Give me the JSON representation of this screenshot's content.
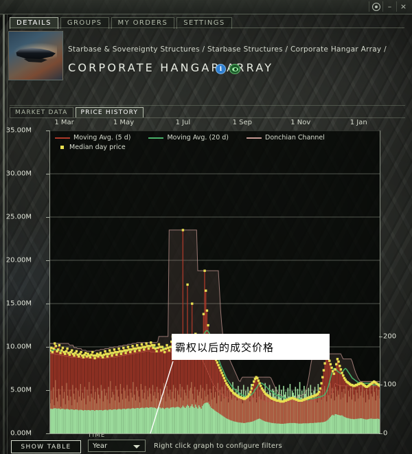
{
  "window": {
    "controls": [
      {
        "name": "target-icon",
        "label": ""
      },
      {
        "name": "minimize-button",
        "label": "–"
      },
      {
        "name": "close-button",
        "label": "×"
      }
    ]
  },
  "tabs": [
    {
      "label": "DETAILS",
      "active": true
    },
    {
      "label": "GROUPS",
      "active": false
    },
    {
      "label": "MY ORDERS",
      "active": false
    },
    {
      "label": "SETTINGS",
      "active": false
    }
  ],
  "header": {
    "breadcrumb": "Starbase & Sovereignty Structures / Starbase Structures / Corporate Hangar Array /",
    "title": "CORPORATE HANGAR ARRAY",
    "info_icon": "i",
    "eye_icon": "eye-icon"
  },
  "subtabs": [
    {
      "label": "MARKET DATA",
      "active": false
    },
    {
      "label": "PRICE HISTORY",
      "active": true
    }
  ],
  "annotation": {
    "text": "霸权以后的成交价格"
  },
  "footer": {
    "show_table": "SHOW TABLE",
    "time_label": "TIME",
    "time_value": "Year",
    "hint": "Right click graph to configure filters"
  },
  "colors": {
    "ma5": "#b03a2a",
    "ma20": "#49b36a",
    "donchian": "#c79a94",
    "median": "#e8e052",
    "volume": "#a9efa9",
    "annotation_line": "#ffffff",
    "grid": "#8d9487"
  },
  "chart_data": {
    "type": "line",
    "title": "",
    "xlabel": "",
    "ylabel": "",
    "ylim": [
      0,
      35000000
    ],
    "y2lim": [
      0,
      250
    ],
    "grid": true,
    "legend_position": "top-left",
    "x_tick_labels": [
      "1 Mar",
      "1 May",
      "1 Jul",
      "1 Sep",
      "1 Nov",
      "1 Jan"
    ],
    "x_tick_positions": [
      0.045,
      0.225,
      0.405,
      0.585,
      0.762,
      0.938
    ],
    "y_tick_labels": [
      "0.00M",
      "5.00M",
      "10.00M",
      "15.00M",
      "20.00M",
      "25.00M",
      "30.00M",
      "35.00M"
    ],
    "y_tick_values": [
      0,
      5000000,
      10000000,
      15000000,
      20000000,
      25000000,
      30000000,
      35000000
    ],
    "y2_tick_labels": [
      "0",
      "100",
      "200"
    ],
    "y2_tick_values": [
      0,
      100,
      200
    ],
    "legend": [
      {
        "label": "Moving Avg. (5 d)",
        "color": "#b03a2a",
        "marker": "line"
      },
      {
        "label": "Moving Avg. (20 d)",
        "color": "#49b36a",
        "marker": "line"
      },
      {
        "label": "Donchian Channel",
        "color": "#c79a94",
        "marker": "line"
      },
      {
        "label": "Median day price",
        "color": "#e8e052",
        "marker": "square"
      }
    ],
    "series": [
      {
        "name": "Median day price",
        "type": "scatter",
        "color": "#e8e052",
        "values": [
          9.6,
          9.9,
          9.4,
          9.8,
          10.4,
          10.1,
          9.5,
          9.7,
          10.2,
          9.3,
          9.6,
          9.9,
          9.4,
          9.2,
          9.5,
          9.8,
          9.3,
          9.1,
          9.4,
          9.6,
          9.2,
          9.0,
          9.3,
          9.5,
          9.1,
          8.9,
          9.2,
          9.4,
          9.0,
          8.8,
          9.1,
          9.3,
          8.9,
          9.2,
          9.0,
          8.8,
          9.1,
          9.4,
          9.0,
          8.7,
          9.0,
          9.2,
          8.9,
          9.1,
          9.3,
          9.0,
          8.8,
          9.1,
          9.5,
          9.2,
          8.9,
          9.2,
          9.6,
          9.3,
          9.0,
          9.3,
          9.7,
          9.4,
          9.1,
          9.4,
          9.8,
          9.5,
          9.2,
          9.5,
          9.9,
          9.6,
          9.3,
          9.6,
          10.0,
          9.7,
          9.4,
          9.7,
          10.1,
          9.8,
          9.5,
          9.8,
          10.2,
          9.9,
          9.6,
          9.9,
          10.3,
          10.0,
          9.7,
          10.0,
          10.4,
          10.1,
          9.8,
          10.1,
          10.5,
          10.2,
          9.9,
          10.2,
          9.8,
          9.5,
          9.9,
          10.3,
          10.0,
          9.6,
          10.0,
          9.7,
          9.4,
          9.8,
          10.2,
          9.9,
          9.6,
          10.0,
          10.6,
          11.2,
          10.4,
          9.9,
          10.3,
          11.0,
          10.5,
          10.0,
          9.7,
          10.1,
          23.5,
          10.2,
          9.8,
          10.4,
          17.2,
          10.6,
          9.9,
          10.5,
          15.0,
          10.3,
          9.8,
          11.5,
          10.2,
          9.6,
          10.8,
          10.1,
          9.5,
          10.6,
          13.8,
          18.8,
          16.5,
          14.2,
          12.5,
          11.2,
          10.4,
          9.8,
          9.5,
          9.2,
          8.8,
          8.5,
          8.2,
          7.9,
          7.6,
          7.3,
          7.0,
          6.7,
          6.4,
          6.1,
          5.8,
          5.6,
          5.4,
          5.2,
          5.0,
          4.9,
          4.7,
          4.6,
          4.5,
          4.4,
          4.3,
          4.2,
          4.2,
          4.1,
          4.1,
          4.0,
          4.0,
          4.1,
          4.2,
          4.3,
          4.5,
          4.8,
          5.2,
          5.6,
          6.0,
          6.3,
          6.5,
          6.4,
          6.1,
          5.8,
          5.5,
          5.2,
          5.0,
          4.8,
          4.6,
          4.5,
          4.4,
          4.3,
          4.2,
          4.1,
          4.0,
          4.0,
          3.9,
          3.9,
          3.8,
          3.8,
          3.8,
          3.7,
          3.7,
          3.7,
          3.7,
          3.8,
          3.8,
          3.9,
          3.9,
          4.0,
          4.0,
          4.1,
          4.1,
          4.0,
          4.0,
          3.9,
          3.9,
          3.8,
          3.8,
          3.8,
          3.8,
          3.9,
          3.9,
          4.0,
          4.0,
          4.1,
          4.1,
          4.2,
          4.2,
          4.3,
          4.3,
          4.4,
          4.4,
          4.5,
          4.6,
          4.8,
          5.2,
          5.8,
          6.5,
          7.3,
          8.1,
          8.8,
          9.2,
          8.9,
          8.4,
          8.0,
          7.6,
          7.2,
          6.9,
          7.4,
          8.0,
          8.6,
          8.3,
          7.8,
          7.4,
          7.0,
          6.7,
          6.4,
          6.2,
          6.0,
          5.9,
          5.8,
          5.7,
          5.6,
          5.6,
          5.5,
          5.5,
          5.6,
          5.6,
          5.7,
          5.7,
          5.8,
          5.8,
          5.7,
          5.6,
          5.5,
          5.4,
          5.4,
          5.5,
          5.6,
          5.7,
          5.8,
          5.9,
          6.0,
          5.9,
          5.8,
          5.7,
          5.6,
          5.5
        ]
      },
      {
        "name": "Moving Avg. (20 d)",
        "type": "line",
        "color": "#49b36a",
        "values": [
          9.5,
          9.5,
          9.6,
          9.6,
          9.7,
          9.7,
          9.6,
          9.6,
          9.6,
          9.5,
          9.5,
          9.5,
          9.4,
          9.4,
          9.4,
          9.4,
          9.3,
          9.3,
          9.3,
          9.3,
          9.2,
          9.2,
          9.2,
          9.2,
          9.1,
          9.1,
          9.1,
          9.1,
          9.0,
          9.0,
          9.0,
          9.0,
          9.0,
          9.0,
          9.0,
          8.9,
          9.0,
          9.0,
          9.0,
          8.9,
          9.0,
          9.0,
          9.0,
          9.0,
          9.0,
          9.0,
          9.0,
          9.0,
          9.1,
          9.1,
          9.1,
          9.1,
          9.2,
          9.2,
          9.2,
          9.2,
          9.3,
          9.3,
          9.3,
          9.3,
          9.4,
          9.4,
          9.4,
          9.4,
          9.5,
          9.5,
          9.5,
          9.5,
          9.6,
          9.6,
          9.6,
          9.6,
          9.7,
          9.7,
          9.7,
          9.7,
          9.8,
          9.8,
          9.8,
          9.8,
          9.9,
          9.9,
          9.9,
          9.9,
          10.0,
          10.0,
          10.0,
          10.0,
          10.1,
          10.1,
          10.0,
          10.0,
          9.9,
          9.9,
          9.9,
          10.0,
          10.0,
          9.9,
          9.9,
          9.9,
          9.8,
          9.8,
          9.9,
          9.9,
          9.9,
          9.9,
          10.0,
          10.1,
          10.1,
          10.1,
          10.1,
          10.2,
          10.2,
          10.2,
          10.1,
          10.1,
          10.7,
          10.7,
          10.6,
          10.6,
          11.0,
          11.0,
          10.9,
          10.9,
          11.2,
          11.1,
          11.0,
          11.1,
          11.0,
          10.9,
          11.0,
          10.9,
          10.8,
          10.9,
          11.2,
          11.6,
          11.8,
          11.9,
          11.8,
          11.6,
          11.3,
          11.0,
          10.6,
          10.2,
          9.8,
          9.4,
          9.0,
          8.6,
          8.3,
          7.9,
          7.6,
          7.3,
          7.0,
          6.7,
          6.4,
          6.2,
          6.0,
          5.8,
          5.6,
          5.4,
          5.3,
          5.1,
          5.0,
          4.9,
          4.8,
          4.7,
          4.6,
          4.5,
          4.4,
          4.4,
          4.3,
          4.3,
          4.3,
          4.3,
          4.3,
          4.4,
          4.5,
          4.6,
          4.8,
          5.0,
          5.2,
          5.4,
          5.6,
          5.7,
          5.8,
          5.8,
          5.7,
          5.6,
          5.5,
          5.4,
          5.2,
          5.1,
          5.0,
          4.9,
          4.8,
          4.7,
          4.6,
          4.5,
          4.4,
          4.4,
          4.3,
          4.3,
          4.2,
          4.2,
          4.1,
          4.1,
          4.0,
          4.0,
          4.0,
          4.0,
          4.0,
          4.0,
          4.0,
          4.0,
          4.0,
          4.0,
          4.0,
          4.0,
          4.0,
          3.9,
          3.9,
          3.9,
          3.9,
          3.9,
          3.9,
          3.9,
          3.9,
          4.0,
          4.0,
          4.0,
          4.0,
          4.1,
          4.1,
          4.1,
          4.2,
          4.2,
          4.2,
          4.3,
          4.3,
          4.4,
          4.5,
          4.7,
          5.0,
          5.4,
          5.9,
          6.4,
          6.9,
          7.3,
          7.5,
          7.5,
          7.4,
          7.2,
          7.1,
          7.0,
          6.9,
          7.0,
          7.2,
          7.4,
          7.5,
          7.4,
          7.2,
          7.0,
          6.8,
          6.6,
          6.4,
          6.3,
          6.2,
          6.1,
          6.0,
          5.9,
          5.9,
          5.8,
          5.8,
          5.8,
          5.8,
          5.8,
          5.8,
          5.8,
          5.8,
          5.8,
          5.7,
          5.7,
          5.6,
          5.6,
          5.6,
          5.6,
          5.7,
          5.7,
          5.8,
          5.8,
          5.9,
          5.9,
          5.8,
          5.8,
          5.7,
          5.6,
          5.6
        ]
      }
    ],
    "volume": {
      "name": "Volume",
      "color": "#a9efa9",
      "axis": "right",
      "values": [
        62,
        88,
        70,
        95,
        58,
        110,
        74,
        66,
        92,
        80,
        55,
        98,
        72,
        86,
        60,
        104,
        78,
        68,
        90,
        76,
        58,
        100,
        82,
        70,
        94,
        64,
        88,
        76,
        102,
        68,
        84,
        72,
        96,
        60,
        90,
        78,
        106,
        66,
        82,
        74,
        98,
        70,
        86,
        62,
        94,
        80,
        72,
        100,
        88,
        66,
        92,
        78,
        84,
        70,
        96,
        62,
        108,
        74,
        86,
        80,
        68,
        98,
        90,
        76,
        64,
        102,
        82,
        70,
        94,
        88,
        72,
        100,
        78,
        66,
        92,
        84,
        74,
        106,
        80,
        68,
        96,
        88,
        76,
        64,
        102,
        90,
        72,
        84,
        98,
        70,
        88,
        76,
        94,
        82,
        66,
        100,
        78,
        86,
        72,
        96,
        84,
        68,
        92,
        80,
        74,
        104,
        88,
        66,
        98,
        82,
        76,
        90,
        70,
        86,
        100,
        72,
        94,
        66,
        88,
        80,
        102,
        74,
        96,
        68,
        90,
        84,
        78,
        100,
        72,
        88,
        94,
        106,
        82,
        70,
        96,
        64,
        90,
        78,
        86,
        100,
        72,
        94,
        68,
        88,
        76,
        102,
        80,
        66,
        92,
        84,
        70,
        98,
        74,
        86,
        62,
        104,
        78,
        90,
        66,
        96,
        82,
        72,
        100,
        76,
        88,
        64,
        94,
        80,
        70,
        106,
        86,
        74,
        92,
        68,
        98,
        82,
        76,
        90,
        62,
        100,
        78,
        88,
        72,
        96,
        84,
        66,
        102,
        80,
        74,
        92,
        86,
        64,
        98,
        76,
        90,
        70,
        94,
        82,
        68,
        104,
        78,
        86,
        72,
        100,
        84,
        66,
        92,
        88,
        76,
        96,
        70,
        82,
        100,
        74,
        90,
        64,
        98,
        80,
        86,
        72,
        94,
        76,
        102,
        68,
        88,
        84,
        78,
        96,
        70,
        92,
        80,
        106,
        74,
        88,
        66,
        98,
        82,
        90,
        76,
        94,
        68,
        100,
        84,
        72,
        88,
        96,
        78,
        64,
        102,
        80,
        86,
        70,
        92,
        74,
        98,
        82,
        66,
        90,
        78,
        104,
        72,
        94,
        84,
        68,
        96,
        76,
        88,
        80,
        100,
        70,
        86,
        74,
        92,
        82,
        98,
        64,
        88,
        76,
        94,
        70,
        102,
        80,
        66,
        90,
        84,
        72,
        96,
        78,
        86,
        100,
        74,
        88,
        64,
        92,
        80,
        70,
        98,
        82,
        76,
        104,
        86,
        68,
        94,
        78,
        90,
        72
      ]
    },
    "annotations": [
      {
        "text": "霸权以后的成交价格",
        "box_rect": [
          236,
          313,
          230,
          38
        ],
        "leader_from": [
          247,
          353
        ],
        "leader_to": [
          208,
          477
        ],
        "highlight_rect": [
          200,
          464,
          80,
          30
        ]
      }
    ]
  }
}
